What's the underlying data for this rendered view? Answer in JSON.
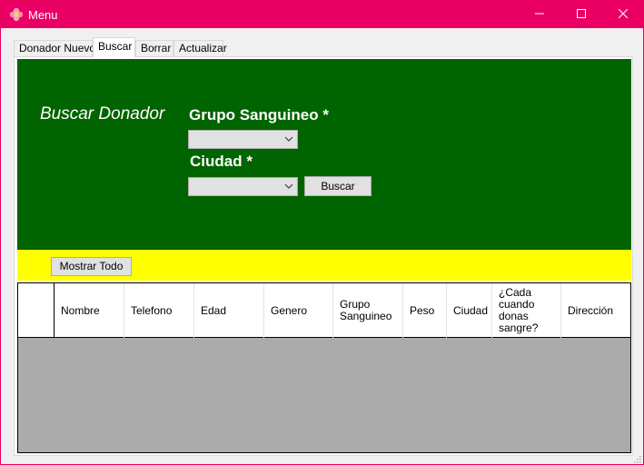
{
  "window": {
    "title": "Menu",
    "accent_color": "#ea0064",
    "app_icon": "flower-icon",
    "controls": {
      "minimize_icon": "minimize-icon",
      "maximize_icon": "maximize-icon",
      "close_icon": "close-icon"
    }
  },
  "tabs": [
    {
      "label": "Donador Nuevo",
      "active": false
    },
    {
      "label": "Buscar",
      "active": true
    },
    {
      "label": "Borrar",
      "active": false
    },
    {
      "label": "Actualizar",
      "active": false
    }
  ],
  "search_panel": {
    "background_color": "#006400",
    "heading": "Buscar Donador",
    "blood_group_label": "Grupo Sanguineo *",
    "blood_group_value": "",
    "city_label": "Ciudad *",
    "city_value": "",
    "search_button": "Buscar"
  },
  "toolbar": {
    "background_color": "#ffff00",
    "show_all_button": "Mostrar Todo"
  },
  "grid": {
    "columns": [
      "Nombre",
      "Telefono",
      "Edad",
      "Genero",
      "Grupo\nSanguineo",
      "Peso",
      "Ciudad",
      "¿Cada\ncuando\ndonas\nsangre?",
      "Dirección"
    ],
    "rows": []
  }
}
